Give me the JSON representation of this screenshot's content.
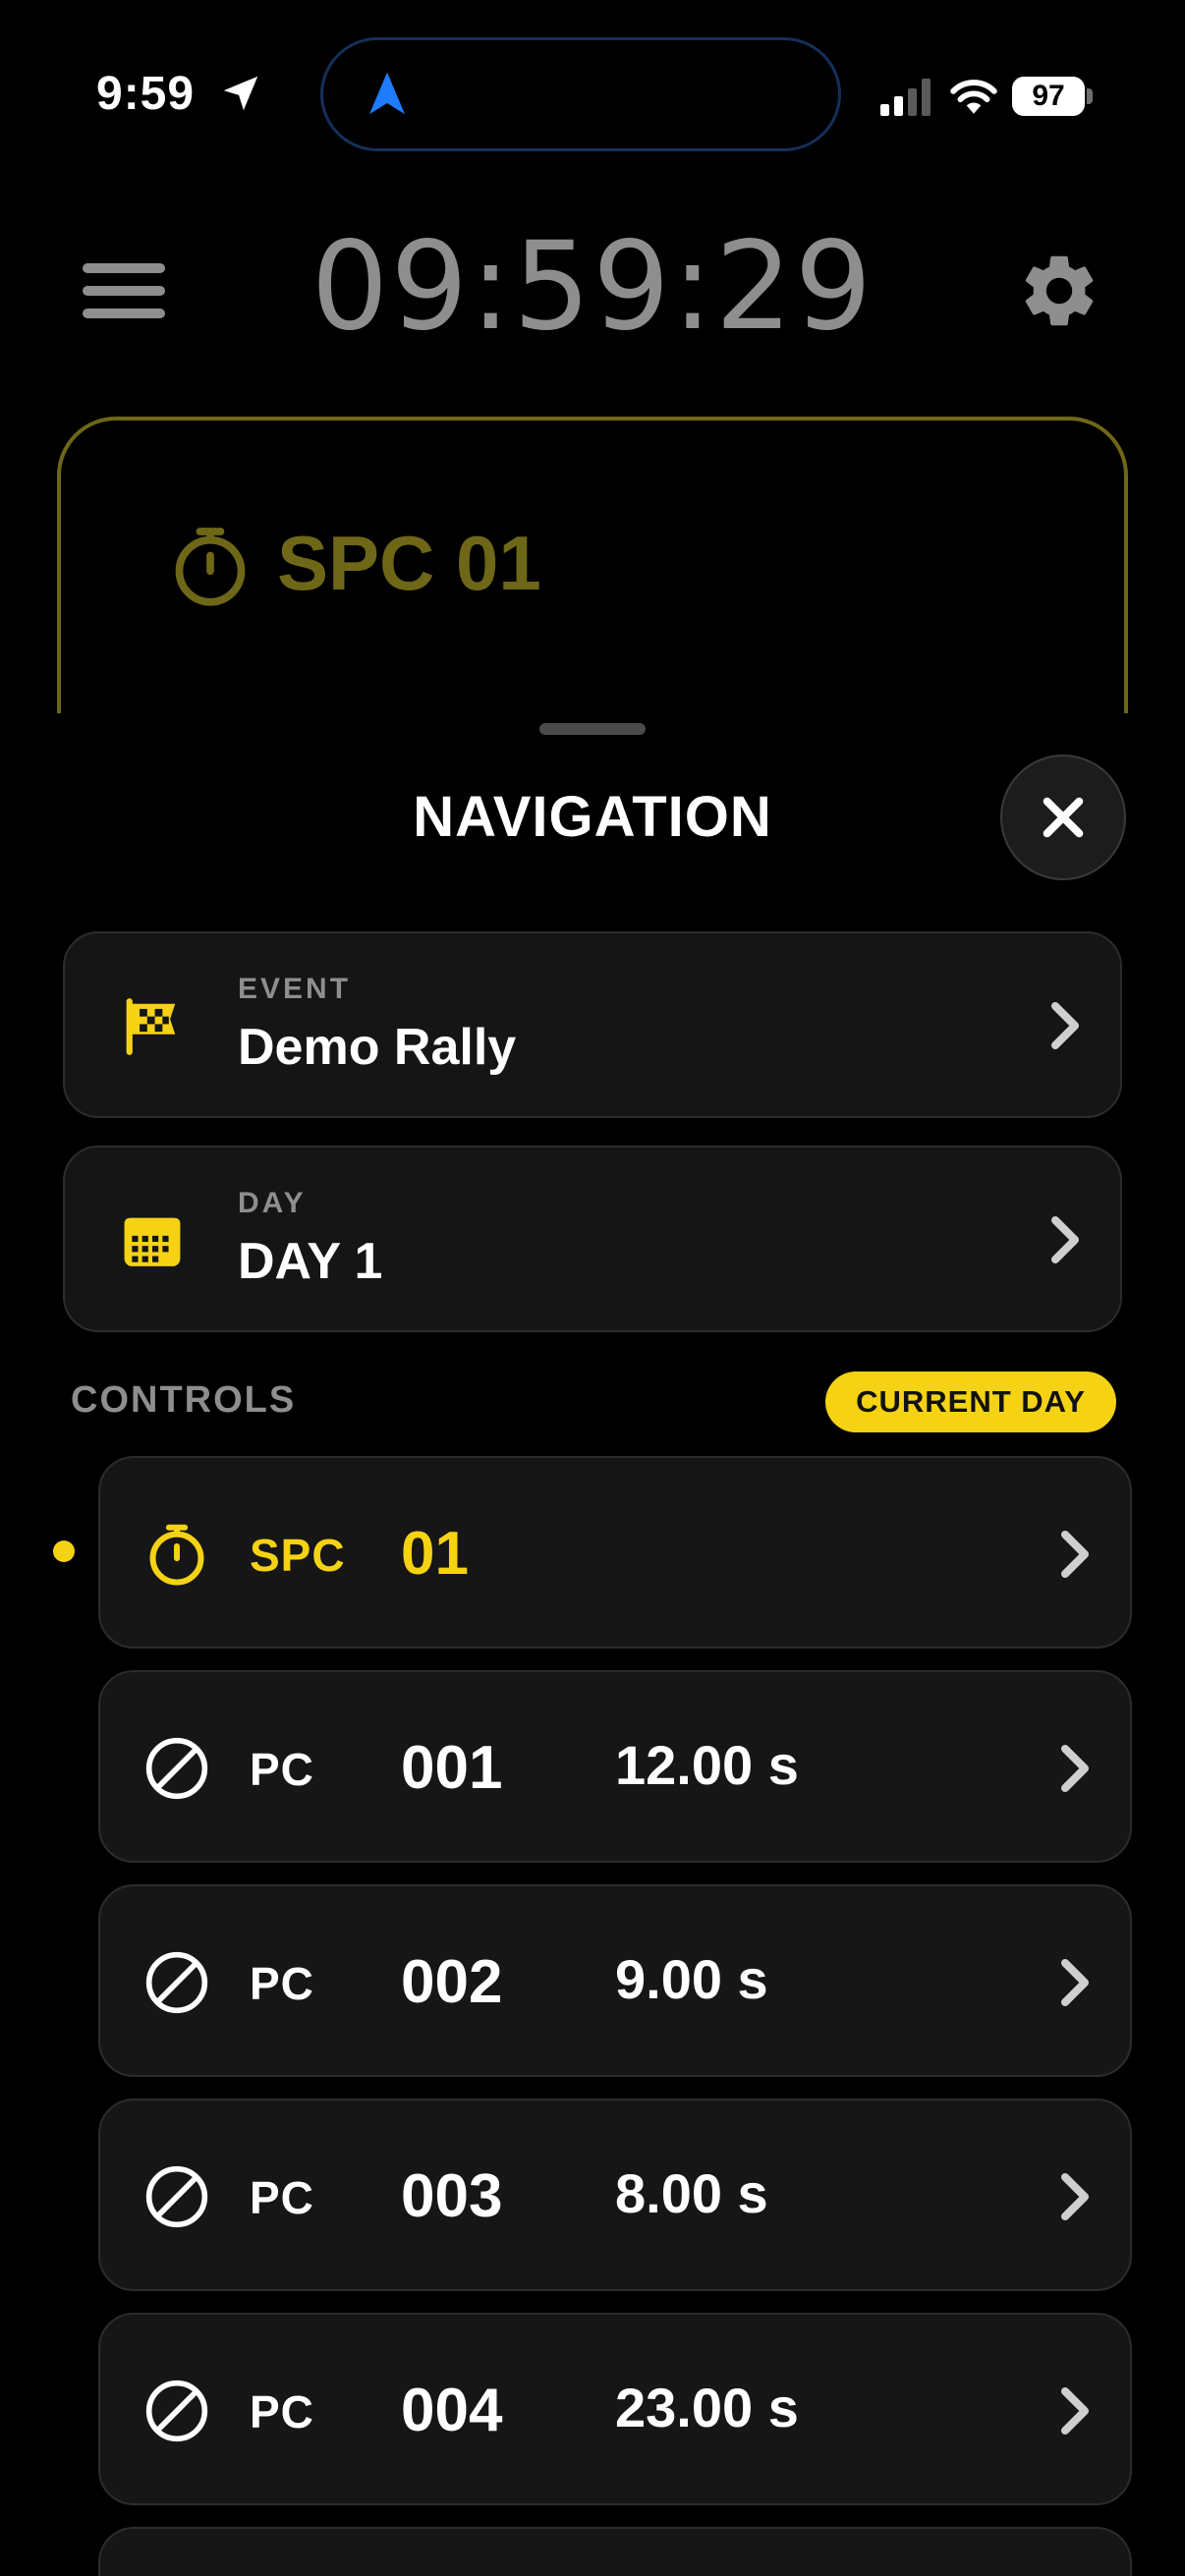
{
  "status_bar": {
    "time": "9:59",
    "battery": "97"
  },
  "header": {
    "clock": "09:59:29"
  },
  "backdrop_card": {
    "title": "SPC 01"
  },
  "sheet": {
    "title": "NAVIGATION",
    "event": {
      "label": "EVENT",
      "value": "Demo Rally"
    },
    "day": {
      "label": "DAY",
      "value": "DAY 1"
    },
    "controls_heading": "CONTROLS",
    "badge": "CURRENT DAY",
    "controls": [
      {
        "type": "SPC",
        "number": "01",
        "value": ""
      },
      {
        "type": "PC",
        "number": "001",
        "value": "12.00 s"
      },
      {
        "type": "PC",
        "number": "002",
        "value": "9.00 s"
      },
      {
        "type": "PC",
        "number": "003",
        "value": "8.00 s"
      },
      {
        "type": "PC",
        "number": "004",
        "value": "23.00 s"
      }
    ]
  },
  "colors": {
    "accent": "#f5d214",
    "dim_accent": "#6e6717",
    "card_bg": "#151515",
    "muted_text": "#8e8e8e"
  },
  "icons": [
    "location-arrow-icon",
    "navigation-arrow-icon",
    "signal-icon",
    "wifi-icon",
    "hamburger-menu-icon",
    "gear-icon",
    "stopwatch-icon",
    "close-icon",
    "checkered-flag-icon",
    "calendar-icon",
    "no-entry-icon",
    "chevron-right-icon"
  ]
}
